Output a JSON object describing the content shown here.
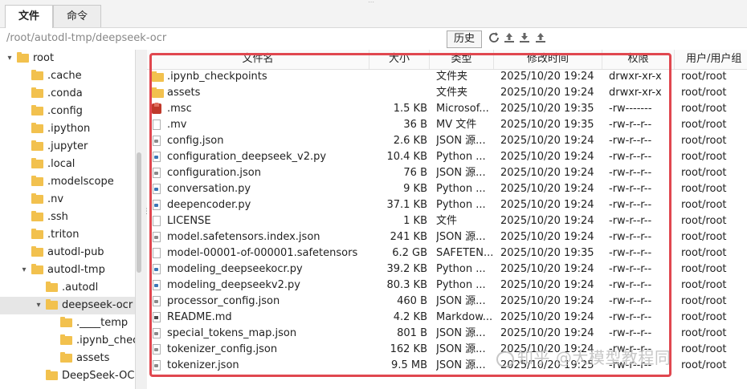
{
  "tabs": [
    {
      "label": "文件",
      "active": true
    },
    {
      "label": "命令",
      "active": false
    }
  ],
  "path": "/root/autodl-tmp/deepseek-ocr",
  "history_label": "历史",
  "toolbar_icons": [
    "refresh-icon",
    "upload-icon",
    "download-icon",
    "upload-alt-icon"
  ],
  "tree": [
    {
      "label": "root",
      "depth": 0,
      "expanded": true,
      "selected": false
    },
    {
      "label": ".cache",
      "depth": 1,
      "selected": false
    },
    {
      "label": ".conda",
      "depth": 1,
      "selected": false
    },
    {
      "label": ".config",
      "depth": 1,
      "selected": false
    },
    {
      "label": ".ipython",
      "depth": 1,
      "selected": false
    },
    {
      "label": ".jupyter",
      "depth": 1,
      "selected": false
    },
    {
      "label": ".local",
      "depth": 1,
      "selected": false
    },
    {
      "label": ".modelscope",
      "depth": 1,
      "selected": false
    },
    {
      "label": ".nv",
      "depth": 1,
      "selected": false
    },
    {
      "label": ".ssh",
      "depth": 1,
      "selected": false
    },
    {
      "label": ".triton",
      "depth": 1,
      "selected": false
    },
    {
      "label": "autodl-pub",
      "depth": 1,
      "selected": false
    },
    {
      "label": "autodl-tmp",
      "depth": 1,
      "expanded": true,
      "selected": false
    },
    {
      "label": ".autodl",
      "depth": 2,
      "selected": false
    },
    {
      "label": "deepseek-ocr",
      "depth": 2,
      "expanded": true,
      "selected": true
    },
    {
      "label": ".____temp",
      "depth": 3,
      "selected": false
    },
    {
      "label": ".ipynb_chec",
      "depth": 3,
      "selected": false
    },
    {
      "label": "assets",
      "depth": 3,
      "selected": false
    },
    {
      "label": "DeepSeek-OCI",
      "depth": 2,
      "selected": false
    }
  ],
  "columns": [
    "文件名",
    "大小",
    "类型",
    "修改时间",
    "权限",
    "用户/用户组"
  ],
  "files": [
    {
      "name": ".ipynb_checkpoints",
      "size": "",
      "type": "文件夹",
      "mtime": "2025/10/20 19:24",
      "perm": "drwxr-xr-x",
      "owner": "root/root",
      "icon": "folder"
    },
    {
      "name": "assets",
      "size": "",
      "type": "文件夹",
      "mtime": "2025/10/20 19:24",
      "perm": "drwxr-xr-x",
      "owner": "root/root",
      "icon": "folder"
    },
    {
      "name": ".msc",
      "size": "1.5 KB",
      "type": "Microsof...",
      "mtime": "2025/10/20 19:35",
      "perm": "-rw-------",
      "owner": "root/root",
      "icon": "msc"
    },
    {
      "name": ".mv",
      "size": "36 B",
      "type": "MV 文件",
      "mtime": "2025/10/20 19:35",
      "perm": "-rw-r--r--",
      "owner": "root/root",
      "icon": "doc"
    },
    {
      "name": "config.json",
      "size": "2.6 KB",
      "type": "JSON 源...",
      "mtime": "2025/10/20 19:24",
      "perm": "-rw-r--r--",
      "owner": "root/root",
      "icon": "json"
    },
    {
      "name": "configuration_deepseek_v2.py",
      "size": "10.4 KB",
      "type": "Python ...",
      "mtime": "2025/10/20 19:24",
      "perm": "-rw-r--r--",
      "owner": "root/root",
      "icon": "py"
    },
    {
      "name": "configuration.json",
      "size": "76 B",
      "type": "JSON 源...",
      "mtime": "2025/10/20 19:24",
      "perm": "-rw-r--r--",
      "owner": "root/root",
      "icon": "json"
    },
    {
      "name": "conversation.py",
      "size": "9 KB",
      "type": "Python ...",
      "mtime": "2025/10/20 19:24",
      "perm": "-rw-r--r--",
      "owner": "root/root",
      "icon": "py"
    },
    {
      "name": "deepencoder.py",
      "size": "37.1 KB",
      "type": "Python ...",
      "mtime": "2025/10/20 19:24",
      "perm": "-rw-r--r--",
      "owner": "root/root",
      "icon": "py"
    },
    {
      "name": "LICENSE",
      "size": "1 KB",
      "type": "文件",
      "mtime": "2025/10/20 19:24",
      "perm": "-rw-r--r--",
      "owner": "root/root",
      "icon": "doc"
    },
    {
      "name": "model.safetensors.index.json",
      "size": "241 KB",
      "type": "JSON 源...",
      "mtime": "2025/10/20 19:24",
      "perm": "-rw-r--r--",
      "owner": "root/root",
      "icon": "json"
    },
    {
      "name": "model-00001-of-000001.safetensors",
      "size": "6.2 GB",
      "type": "SAFETEN...",
      "mtime": "2025/10/20 19:35",
      "perm": "-rw-r--r--",
      "owner": "root/root",
      "icon": "doc"
    },
    {
      "name": "modeling_deepseekocr.py",
      "size": "39.2 KB",
      "type": "Python ...",
      "mtime": "2025/10/20 19:24",
      "perm": "-rw-r--r--",
      "owner": "root/root",
      "icon": "py"
    },
    {
      "name": "modeling_deepseekv2.py",
      "size": "80.3 KB",
      "type": "Python ...",
      "mtime": "2025/10/20 19:24",
      "perm": "-rw-r--r--",
      "owner": "root/root",
      "icon": "py"
    },
    {
      "name": "processor_config.json",
      "size": "460 B",
      "type": "JSON 源...",
      "mtime": "2025/10/20 19:24",
      "perm": "-rw-r--r--",
      "owner": "root/root",
      "icon": "json"
    },
    {
      "name": "README.md",
      "size": "4.2 KB",
      "type": "Markdow...",
      "mtime": "2025/10/20 19:24",
      "perm": "-rw-r--r--",
      "owner": "root/root",
      "icon": "md"
    },
    {
      "name": "special_tokens_map.json",
      "size": "801 B",
      "type": "JSON 源...",
      "mtime": "2025/10/20 19:24",
      "perm": "-rw-r--r--",
      "owner": "root/root",
      "icon": "json"
    },
    {
      "name": "tokenizer_config.json",
      "size": "162 KB",
      "type": "JSON 源...",
      "mtime": "2025/10/20 19:24",
      "perm": "-rw-r--r--",
      "owner": "root/root",
      "icon": "json"
    },
    {
      "name": "tokenizer.json",
      "size": "9.5 MB",
      "type": "JSON 源...",
      "mtime": "2025/10/20 19:25",
      "perm": "-rw-r--r--",
      "owner": "root/root",
      "icon": "json"
    }
  ],
  "watermark": "知乎 @大模型教程同",
  "colors": {
    "highlight_border": "#e0474f",
    "folder": "#f2c14e",
    "selected_row": "#e6e6e6"
  }
}
